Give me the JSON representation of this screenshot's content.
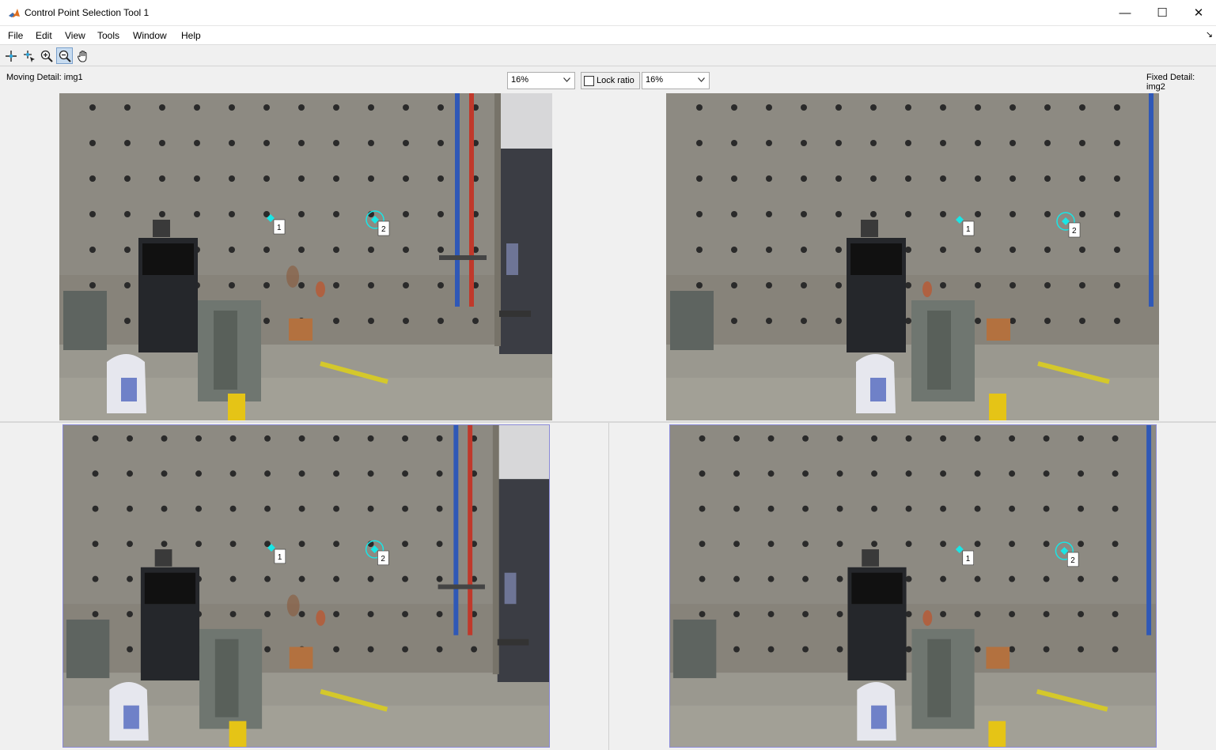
{
  "window": {
    "title": "Control Point Selection Tool 1",
    "minimize_glyph": "—",
    "maximize_glyph": "☐",
    "close_glyph": "✕"
  },
  "menu": {
    "items": [
      "File",
      "Edit",
      "View",
      "Tools",
      "Window",
      "Help"
    ],
    "dock_glyph": "↘"
  },
  "toolbar": {
    "tools": [
      {
        "name": "add-point-icon",
        "active": false
      },
      {
        "name": "select-point-icon",
        "active": false
      },
      {
        "name": "zoom-in-icon",
        "active": false
      },
      {
        "name": "zoom-out-icon",
        "active": true
      },
      {
        "name": "pan-hand-icon",
        "active": false
      }
    ]
  },
  "detail": {
    "moving_label": "Moving Detail: img1",
    "fixed_label": "Fixed Detail: img2",
    "moving_zoom": "16%",
    "fixed_zoom": "16%",
    "lock_ratio_label": "Lock ratio",
    "lock_ratio_checked": false
  },
  "control_points": [
    {
      "label": "1"
    },
    {
      "label": "2"
    }
  ],
  "colors": {
    "point_cyan": "#19e6e6",
    "concrete": "#8d8a82",
    "floor": "#9a988f",
    "overview_border": "#8a8ad8"
  }
}
